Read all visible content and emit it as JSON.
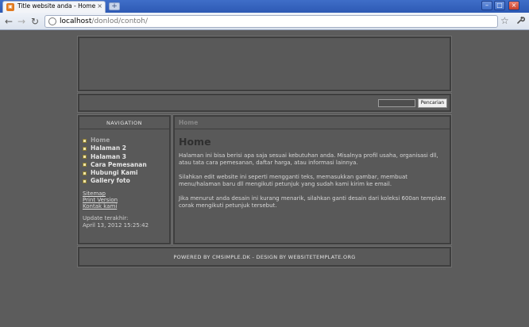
{
  "browser": {
    "tab_title": "Title website anda - Home",
    "tab_close": "×",
    "new_tab": "+",
    "url_host": "localhost",
    "url_path": "/donlod/contoh/",
    "back": "←",
    "forward": "→",
    "reload": "↻",
    "star": "☆",
    "wrench": "🔧",
    "window_controls": {
      "minimize": "–",
      "maximize": "□",
      "close": "×"
    }
  },
  "search": {
    "button_label": "Pencarian",
    "input_value": ""
  },
  "sidebar": {
    "title": "NAVIGATION",
    "items": [
      {
        "label": "Home",
        "active": true
      },
      {
        "label": "Halaman 2"
      },
      {
        "label": "Halaman 3"
      },
      {
        "label": "Cara Pemesanan"
      },
      {
        "label": "Hubungi Kami"
      },
      {
        "label": "Gallery foto"
      }
    ],
    "links": [
      "Sitemap",
      "Print Version",
      "Kontak kami"
    ],
    "update_label": "Update terakhir:",
    "update_value": "April 13, 2012 15:25:42"
  },
  "content": {
    "breadcrumb": "Home",
    "title": "Home",
    "paragraphs": [
      "Halaman ini bisa berisi apa saja sesuai kebutuhan anda. Misalnya profil usaha, organisasi dll, atau tata cara pemesanan, daftar harga, atau informasi lainnya.",
      "Silahkan edit website ini seperti mengganti teks, memasukkan gambar, membuat menu/halaman baru dll mengikuti petunjuk yang sudah kami kirim ke email.",
      "Jika menurut anda desain ini kurang menarik, silahkan ganti desain dari koleksi 600an template corak mengikuti petunjuk tersebut."
    ]
  },
  "footer": {
    "text": "POWERED BY CMSIMPLE.DK - DESIGN BY WEBSITETEMPLATE.ORG"
  },
  "colors": {
    "page_bg": "#5c5c5c",
    "panel_bg": "#595959",
    "border_dark": "#3e3e3e",
    "title_text": "#2f2f2f"
  }
}
